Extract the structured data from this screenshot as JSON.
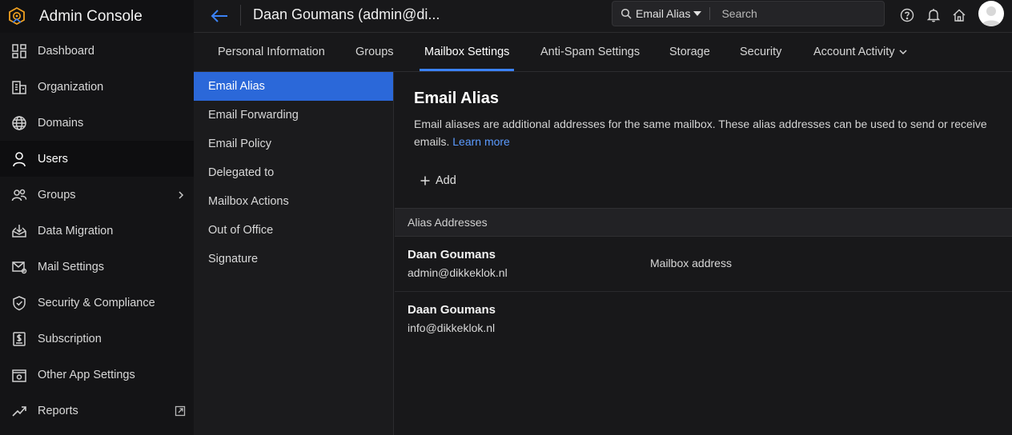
{
  "app": {
    "title": "Admin Console"
  },
  "sidebar": {
    "items": [
      {
        "label": "Dashboard",
        "icon": "dashboard-icon"
      },
      {
        "label": "Organization",
        "icon": "organization-icon"
      },
      {
        "label": "Domains",
        "icon": "globe-icon"
      },
      {
        "label": "Users",
        "icon": "user-icon",
        "active": true
      },
      {
        "label": "Groups",
        "icon": "groups-icon"
      },
      {
        "label": "Data Migration",
        "icon": "data-migration-icon"
      },
      {
        "label": "Mail Settings",
        "icon": "mail-settings-icon"
      },
      {
        "label": "Security & Compliance",
        "icon": "shield-icon"
      },
      {
        "label": "Subscription",
        "icon": "subscription-icon"
      },
      {
        "label": "Other App Settings",
        "icon": "app-settings-icon"
      },
      {
        "label": "Reports",
        "icon": "reports-icon"
      }
    ]
  },
  "header": {
    "user_title": "Daan Goumans (admin@di...",
    "search_scope": "Email Alias",
    "search_placeholder": "Search"
  },
  "tabs": [
    {
      "label": "Personal Information"
    },
    {
      "label": "Groups"
    },
    {
      "label": "Mailbox Settings",
      "active": true
    },
    {
      "label": "Anti-Spam Settings"
    },
    {
      "label": "Storage"
    },
    {
      "label": "Security"
    },
    {
      "label": "Account Activity"
    }
  ],
  "subnav": {
    "items": [
      {
        "label": "Email Alias",
        "active": true
      },
      {
        "label": "Email Forwarding"
      },
      {
        "label": "Email Policy"
      },
      {
        "label": "Delegated to"
      },
      {
        "label": "Mailbox Actions"
      },
      {
        "label": "Out of Office"
      },
      {
        "label": "Signature"
      }
    ]
  },
  "main": {
    "title": "Email Alias",
    "description": "Email aliases are additional addresses for the same mailbox. These alias addresses can be used to send or receive emails.",
    "learn_more": "Learn more",
    "add_label": "Add",
    "table_header": "Alias Addresses",
    "rows": [
      {
        "name": "Daan Goumans",
        "email": "admin@dikkeklok.nl",
        "tag": "Mailbox address"
      },
      {
        "name": "Daan Goumans",
        "email": "info@dikkeklok.nl",
        "tag": ""
      }
    ]
  },
  "colors": {
    "accent": "#3b82f6",
    "active_subnav": "#2b68d9",
    "link": "#5b9bff",
    "brand": "#f0a020"
  }
}
